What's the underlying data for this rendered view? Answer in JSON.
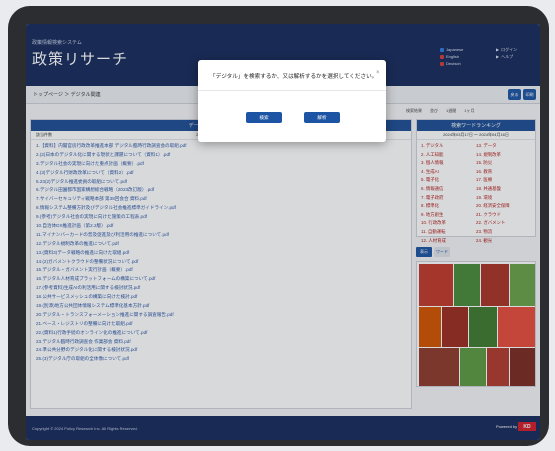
{
  "header": {
    "system_name": "政策情報検索システム",
    "app_title": "政策リサーチ",
    "links": [
      {
        "label": "Japanese",
        "color": "#2d7be0"
      },
      {
        "label": "English",
        "color": "#d13b3b"
      },
      {
        "label": "Deutsch",
        "color": "#d13b3b"
      }
    ],
    "right_links": [
      "ログイン",
      "ヘルプ"
    ]
  },
  "toolbar": {
    "breadcrumb": "トップページ ＞ デジタル関連",
    "btn1_label": "戻る",
    "btn2_label": "印刷"
  },
  "options": [
    "検索結果",
    "並び",
    "1週間",
    "1ヶ月"
  ],
  "results": {
    "title": "データ・デジタルランキング",
    "count_label": "該当件数",
    "date_range": "2024年03月17日 ～ 2024年04月16日",
    "items": [
      "1.【資料】内閣官房行政改革推進本部 デジタル臨時行政調査会の取組.pdf",
      "2.(2)日本のデジタル化に関する現状と課題について（資料1）.pdf",
      "3.デジタル社会の実現に向けた重点計画（概要）.pdf",
      "4.(3)デジタル行財政改革について（資料2）.pdf",
      "5.23(2)デジタル推進委員の取組について.pdf",
      "6.デジタル田園都市国家構想総合戦略（2023改訂版）.pdf",
      "7.サイバーセキュリティ戦略本部 第38回会合 資料.pdf",
      "8.情報システム整備方針及びデジタル社会推進標準ガイドライン.pdf",
      "9.(参考)デジタル社会の実現に向けた施策の工程表.pdf",
      "10.自治体DX推進計画（第2.2版）.pdf",
      "11.マイナンバーカードの普及促進及び利活用の推進について.pdf",
      "12.デジタル規制改革の推進について.pdf",
      "13.(資料3)データ戦略の推進に向けた取組.pdf",
      "14.(2)ガバメントクラウドの整備状況について.pdf",
      "15.デジタル・ガバメント実行計画（概要）.pdf",
      "16.デジタル人材育成プラットフォームの構築について.pdf",
      "17.(参考資料)生成AIの利活用に関する検討状況.pdf",
      "18.公共サービスメッシュの構築に向けた検討.pdf",
      "19.(別添)地方公共団体情報システム標準化基本方針.pdf",
      "20.デジタル・トランスフォーメーション推進に関する調査報告.pdf",
      "21.ベース・レジストリの整備に向けた取組.pdf",
      "22.(資料1)行政手続のオンライン化の推進について.pdf",
      "23.デジタル臨時行政調査会 作業部会 資料.pdf",
      "24.準公共分野のデジタル化に関する検討状況.pdf",
      "25.(3)デジタル庁の取組の全体像について.pdf"
    ]
  },
  "keywords": {
    "title": "検索ワードランキング",
    "date_range": "2024年03月17日 ～ 2024年04月16日",
    "left": [
      "1. デジタル",
      "2. 人工知能",
      "3. 個人情報",
      "4. 生成AI",
      "5. 電子化",
      "6. 情報通信",
      "7. 電子政府",
      "8. 標準化",
      "9. 地方創生",
      "10. 行政改革",
      "11. 自動運転",
      "12. 人材育成"
    ],
    "right": [
      "13. データ",
      "14. 規制改革",
      "15. 防災",
      "16. 教育",
      "17. 医療",
      "18. 共通基盤",
      "19. 環境",
      "20. 経済安全保障",
      "21. クラウド",
      "22. ガバメント",
      "23. 物流",
      "24. 観光"
    ]
  },
  "tabs": [
    "表示",
    "ワード"
  ],
  "treemap_colors": [
    "#c0392b",
    "#4a8a3a",
    "#a93226",
    "#6aa34a",
    "#d35400",
    "#9b2d20",
    "#3f7a2f",
    "#e74c3c",
    "#8e3a2a",
    "#5c9a43",
    "#b03a2e",
    "#7a2a20"
  ],
  "footer": {
    "copyright": "Copyright © 2024 Policy Research Inc. All Rights Reserved.",
    "right_text": "Powered by",
    "logo_text": "KD"
  },
  "dialog": {
    "message": "「デジタル」を検索するか、又は解析するかを選択してください。",
    "close": "×",
    "search_label": "検索",
    "analyze_label": "解析"
  }
}
